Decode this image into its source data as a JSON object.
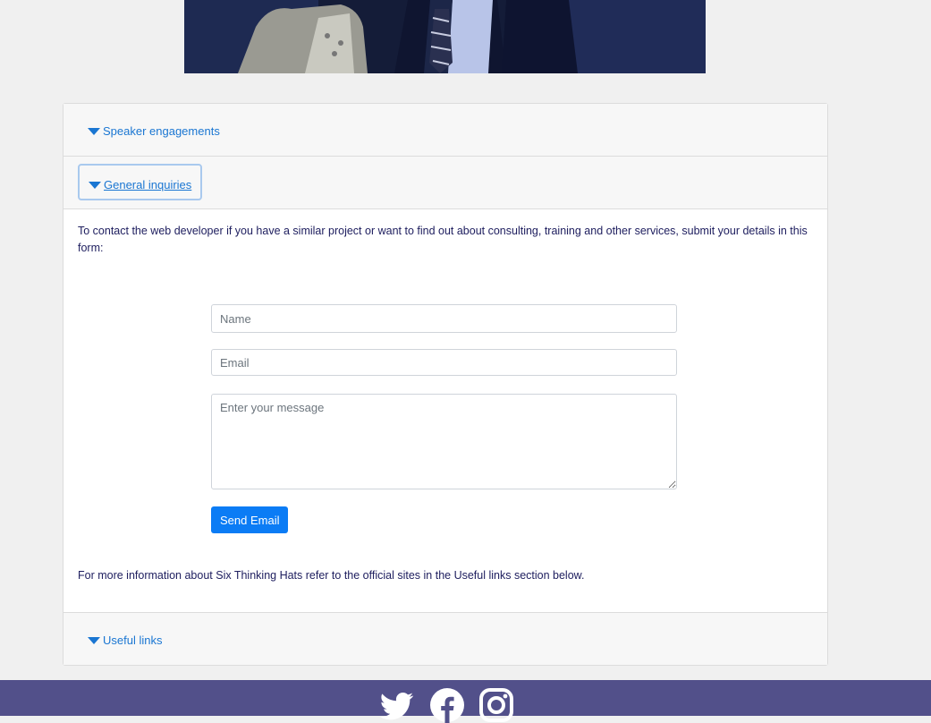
{
  "accordion": {
    "speaker_label": "Speaker engagements",
    "general_label": "General inquiries",
    "useful_label": "Useful links"
  },
  "contact": {
    "intro": "To contact the web developer if you have a similar project or want to find out about consulting, training and other services, submit your details in this form:",
    "name_placeholder": "Name",
    "email_placeholder": "Email",
    "message_placeholder": "Enter your message",
    "send_label": "Send Email",
    "more_info": "For more information about Six Thinking Hats refer to the official sites in the Useful links section below."
  },
  "footer": {
    "social_icons": [
      "twitter-icon",
      "facebook-icon",
      "instagram-icon"
    ]
  },
  "colors": {
    "link": "#1a76d2",
    "button": "#0b7cf5",
    "footer": "#52508a",
    "text": "#202060"
  }
}
